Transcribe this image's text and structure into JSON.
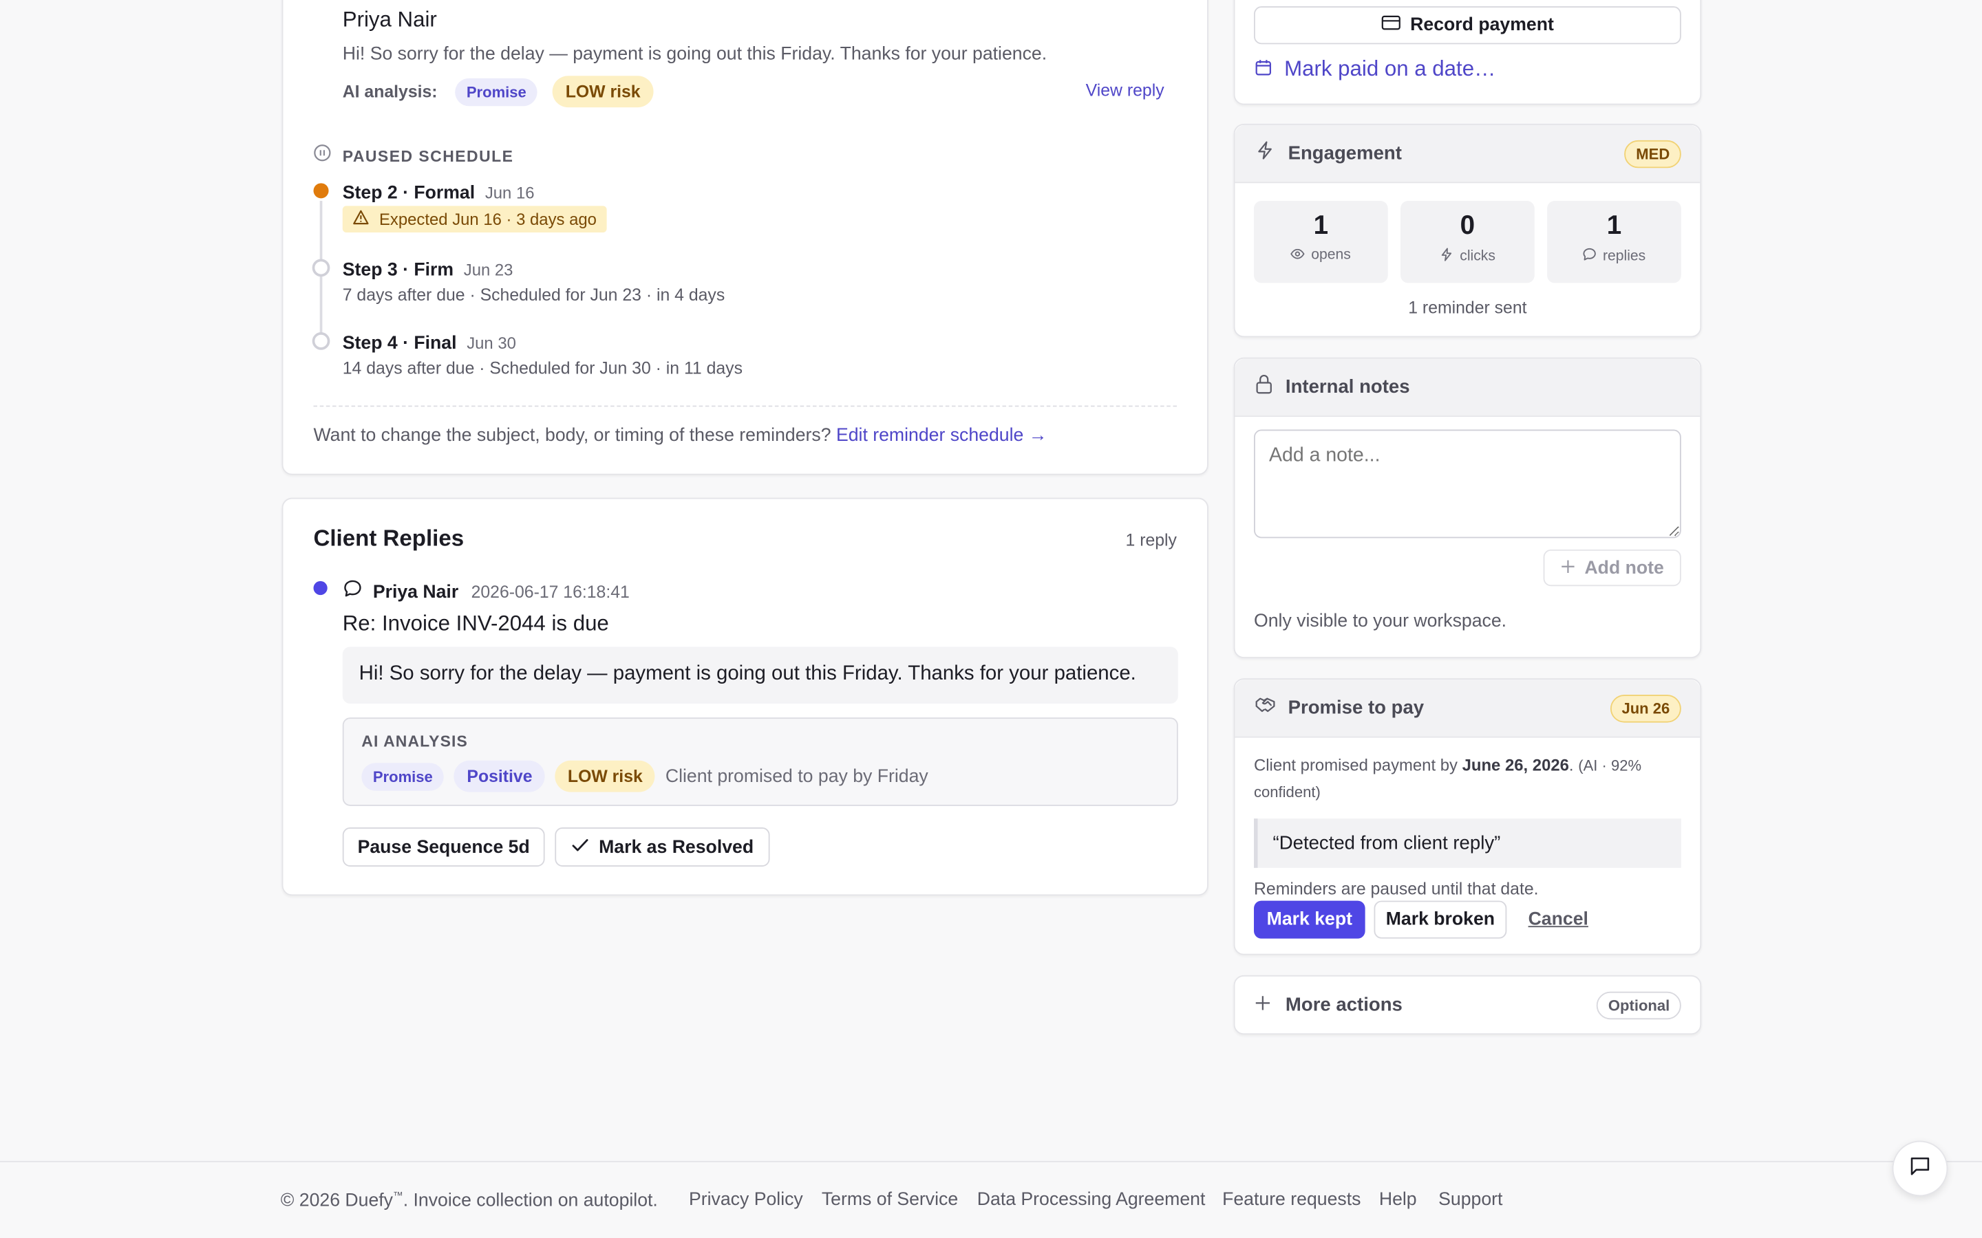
{
  "reply_preview": {
    "sender": "Priya Nair",
    "message": "Hi! So sorry for the delay — payment is going out this Friday. Thanks for your patience.",
    "ai_label": "AI analysis:",
    "intent_tag": "Promise",
    "risk_tag": "LOW risk",
    "view_link": "View reply"
  },
  "schedule": {
    "heading": "PAUSED SCHEDULE",
    "steps": [
      {
        "title": "Step 2 · Formal",
        "date": "Jun 16",
        "alert": "Expected Jun 16 · 3 days ago"
      },
      {
        "title": "Step 3 · Firm",
        "date": "Jun 23",
        "detail": "7 days after due · Scheduled for Jun 23 · in 4 days"
      },
      {
        "title": "Step 4 · Final",
        "date": "Jun 30",
        "detail": "14 days after due · Scheduled for Jun 30 · in 11 days"
      }
    ],
    "change_prompt": "Want to change the subject, body, or timing of these reminders?",
    "edit_link": "Edit reminder schedule →"
  },
  "client_replies": {
    "title": "Client Replies",
    "count": "1 reply",
    "reply": {
      "sender": "Priya Nair",
      "timestamp": "2026-06-17 16:18:41",
      "subject": "Re: Invoice INV-2044 is due",
      "body": "Hi! So sorry for the delay — payment is going out this Friday. Thanks for your patience.",
      "analysis_heading": "AI ANALYSIS",
      "tags": [
        "Promise",
        "Positive",
        "LOW risk"
      ],
      "summary": "Client promised to pay by Friday"
    },
    "pause_button": "Pause Sequence 5d",
    "resolve_button": "Mark as Resolved"
  },
  "payment": {
    "record_button": "Record payment",
    "mark_paid_link": "Mark paid on a date…"
  },
  "engagement": {
    "title": "Engagement",
    "badge": "MED",
    "stats": [
      {
        "value": "1",
        "label": "opens",
        "icon": "eye-icon"
      },
      {
        "value": "0",
        "label": "clicks",
        "icon": "click-icon"
      },
      {
        "value": "1",
        "label": "replies",
        "icon": "chat-icon"
      }
    ],
    "summary": "1 reminder sent"
  },
  "notes": {
    "title": "Internal notes",
    "placeholder": "Add a note...",
    "add_button": "Add note",
    "visibility": "Only visible to your workspace."
  },
  "promise": {
    "title": "Promise to pay",
    "badge": "Jun 26",
    "text_prefix": "Client promised payment by ",
    "date": "June 26, 2026",
    "text_suffix": ".",
    "confidence": "(AI · 92% confident)",
    "quote": "“Detected from client reply”",
    "paused_note": "Reminders are paused until that date.",
    "kept_button": "Mark kept",
    "broken_button": "Mark broken",
    "cancel_link": "Cancel"
  },
  "more_actions": {
    "title": "More actions",
    "badge": "Optional"
  },
  "footer": {
    "copyright_prefix": "© 2026 Duefy",
    "trademark": "™",
    "copyright_suffix": ". Invoice collection on autopilot.",
    "links": [
      "Privacy Policy",
      "Terms of Service",
      "Data Processing Agreement",
      "Feature requests",
      "Help",
      "Support"
    ]
  },
  "colors": {
    "accent": "#4f46e5",
    "warning": "#e07b0c",
    "badge_yellow": "#fdf0c4"
  }
}
